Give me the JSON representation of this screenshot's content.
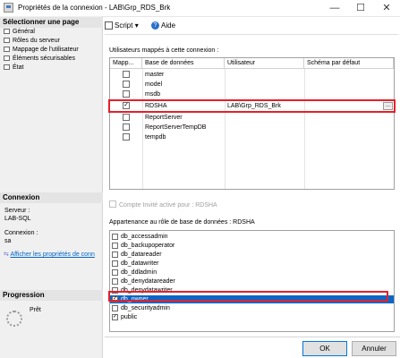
{
  "window": {
    "title": "Propriétés de la connexion - LAB\\Grp_RDS_Brk",
    "minimize": "—",
    "maximize": "☐",
    "close": "✕"
  },
  "left": {
    "pages_header": "Sélectionner une page",
    "pages": [
      "Général",
      "Rôles du serveur",
      "Mappage de l'utilisateur",
      "Éléments sécurisables",
      "État"
    ],
    "connection_header": "Connexion",
    "server_label": "Serveur :",
    "server_value": "LAB-SQL",
    "connection_label": "Connexion :",
    "connection_value": "sa",
    "view_props_link": "Afficher les propriétés de conn",
    "progress_header": "Progression",
    "progress_status": "Prêt"
  },
  "toolbar": {
    "script_label": "Script",
    "script_arrow": "▾",
    "help_label": "Aide"
  },
  "users": {
    "label": "Utilisateurs mappés à cette connexion :",
    "columns": [
      "Mapp...",
      "Base de données",
      "Utilisateur",
      "Schéma par défaut"
    ],
    "rows": [
      {
        "checked": false,
        "db": "master",
        "user": "",
        "schema": ""
      },
      {
        "checked": false,
        "db": "model",
        "user": "",
        "schema": ""
      },
      {
        "checked": false,
        "db": "msdb",
        "user": "",
        "schema": ""
      },
      {
        "checked": true,
        "db": "RDSHA",
        "user": "LAB\\Grp_RDS_Brk",
        "schema": ""
      },
      {
        "checked": false,
        "db": "ReportServer",
        "user": "",
        "schema": ""
      },
      {
        "checked": false,
        "db": "ReportServerTempDB",
        "user": "",
        "schema": ""
      },
      {
        "checked": false,
        "db": "tempdb",
        "user": "",
        "schema": ""
      }
    ],
    "ellipsis": "..."
  },
  "guest": {
    "label": "Compte Invité activé pour : RDSHA",
    "checked": false
  },
  "roles": {
    "label": "Appartenance au rôle de base de données : RDSHA",
    "items": [
      {
        "name": "db_accessadmin",
        "checked": false
      },
      {
        "name": "db_backupoperator",
        "checked": false
      },
      {
        "name": "db_datareader",
        "checked": false
      },
      {
        "name": "db_datawriter",
        "checked": false
      },
      {
        "name": "db_ddladmin",
        "checked": false
      },
      {
        "name": "db_denydatareader",
        "checked": false
      },
      {
        "name": "db_denydatawriter",
        "checked": false
      },
      {
        "name": "db_owner",
        "checked": true
      },
      {
        "name": "db_securityadmin",
        "checked": false
      },
      {
        "name": "public",
        "checked": true
      }
    ]
  },
  "buttons": {
    "ok": "OK",
    "cancel": "Annuler"
  },
  "colors": {
    "highlight": "#e4202a",
    "selection": "#0a66c7"
  }
}
